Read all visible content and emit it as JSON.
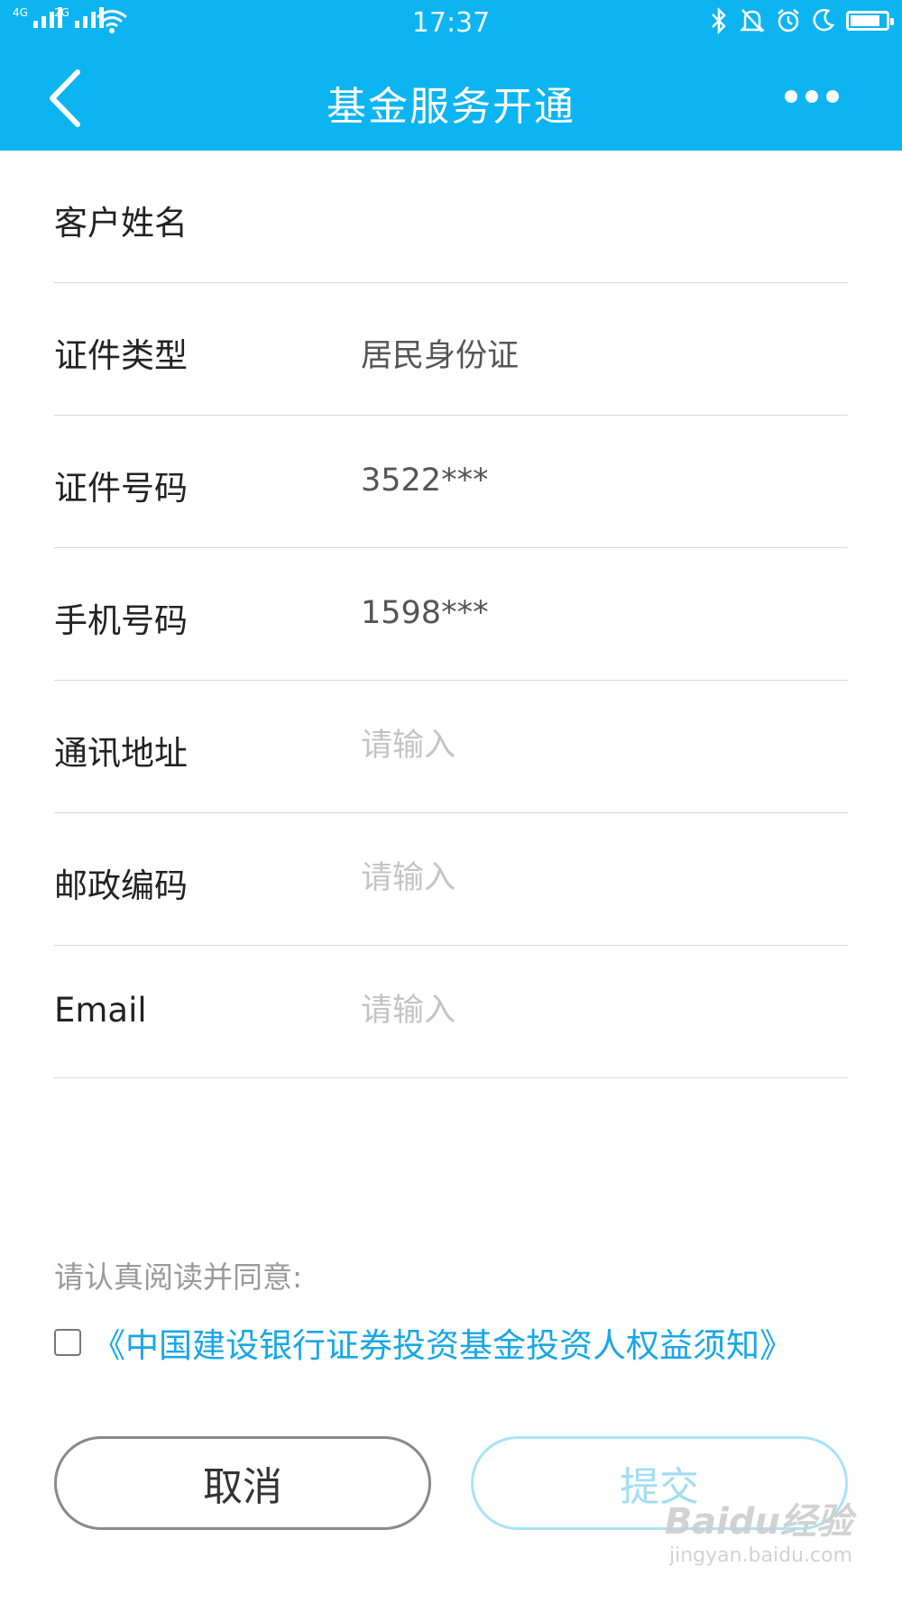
{
  "status_bar": {
    "network_1": "4G",
    "network_2": "2G",
    "time": "17:37",
    "icons": [
      "bluetooth-icon",
      "bell-icon",
      "alarm-icon",
      "moon-icon",
      "battery-icon"
    ],
    "battery_level": 0.85
  },
  "nav": {
    "title": "基金服务开通",
    "back_icon": "chevron-left-icon",
    "more_icon": "more-dots-icon"
  },
  "form": {
    "rows": [
      {
        "label": "客户姓名",
        "value": ""
      },
      {
        "label": "证件类型",
        "value": "居民身份证"
      },
      {
        "label": "证件号码",
        "value": "3522***:"
      },
      {
        "label": "手机号码",
        "value": "1598***"
      },
      {
        "label": "通讯地址",
        "placeholder": "请输入"
      },
      {
        "label": "邮政编码",
        "placeholder": "请输入"
      },
      {
        "label": "Email",
        "placeholder": "请输入"
      }
    ]
  },
  "agreement": {
    "hint": "请认真阅读并同意:",
    "link": "《中国建设银行证券投资基金投资人权益须知》",
    "checked": false
  },
  "buttons": {
    "cancel": "取消",
    "submit": "提交"
  },
  "watermark": {
    "brand": "Baidu经验",
    "url": "jingyan.baidu.com"
  },
  "colors": {
    "primary": "#0db4f2",
    "link": "#18a7e6",
    "submit_disabled": "#a2ddf3"
  }
}
